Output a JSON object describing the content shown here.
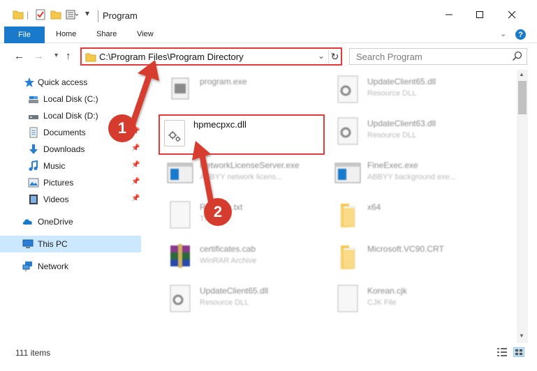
{
  "window": {
    "title": "Program",
    "minimize_icon": "minimize-icon",
    "maximize_icon": "maximize-icon",
    "close_icon": "close-icon"
  },
  "ribbon": {
    "tabs": [
      {
        "label": "File"
      },
      {
        "label": "Home"
      },
      {
        "label": "Share"
      },
      {
        "label": "View"
      }
    ],
    "help_label": "?"
  },
  "address_bar": {
    "path": "C:\\Program Files\\Program Directory"
  },
  "search": {
    "placeholder": "Search Program"
  },
  "sidebar": {
    "items": [
      {
        "label": "Quick access",
        "icon": "star-icon"
      },
      {
        "label": "Local Disk (C:)",
        "icon": "drive-icon"
      },
      {
        "label": "Local Disk (D:)",
        "icon": "drive-icon",
        "pinned": true
      },
      {
        "label": "Documents",
        "icon": "documents-icon",
        "pinned": true
      },
      {
        "label": "Downloads",
        "icon": "download-icon",
        "pinned": true
      },
      {
        "label": "Music",
        "icon": "music-icon",
        "pinned": true
      },
      {
        "label": "Pictures",
        "icon": "pictures-icon",
        "pinned": true
      },
      {
        "label": "Videos",
        "icon": "videos-icon",
        "pinned": true
      },
      {
        "label": "OneDrive",
        "icon": "cloud-icon"
      },
      {
        "label": "This PC",
        "icon": "computer-icon",
        "selected": true
      },
      {
        "label": "Network",
        "icon": "network-icon"
      }
    ]
  },
  "files": [
    {
      "name": "program.exe",
      "type": "",
      "icon": "exe-icon"
    },
    {
      "name": "UpdateClient65.dll",
      "type": "Resource DLL",
      "icon": "dll-gear-icon"
    },
    {
      "name": "UpdateClient63.dll",
      "type": "Resource DLL",
      "icon": "dll-gear-icon"
    },
    {
      "name": "NetworkLicenseServer.exe",
      "type": "ABBYY network licens...",
      "icon": "app-window-icon"
    },
    {
      "name": "FineExec.exe",
      "type": "ABBYY background exe...",
      "icon": "app-window-icon"
    },
    {
      "name": "ReadMe.txt",
      "type": "TXT",
      "icon": "text-file-icon"
    },
    {
      "name": "x64",
      "type": "",
      "icon": "folder-icon"
    },
    {
      "name": "certificates.cab",
      "type": "WinRAR Archive",
      "icon": "archive-icon"
    },
    {
      "name": "Microsoft.VC90.CRT",
      "type": "",
      "icon": "folder-icon"
    },
    {
      "name": "UpdateClient65.dll",
      "type": "Resource DLL",
      "icon": "dll-gear-icon"
    },
    {
      "name": "Korean.cjk",
      "type": "CJK File",
      "icon": "blank-file-icon"
    }
  ],
  "highlighted_file": {
    "name": "hpmecpxc.dll",
    "icon": "dll-gear-icon"
  },
  "annotations": {
    "step_1": "1",
    "step_2": "2",
    "color": "#d63c2e"
  },
  "status": {
    "item_count": "111 items"
  },
  "colors": {
    "accent": "#1979ca",
    "highlight_border": "#e53a3a",
    "selected_bg": "#cce8ff"
  }
}
